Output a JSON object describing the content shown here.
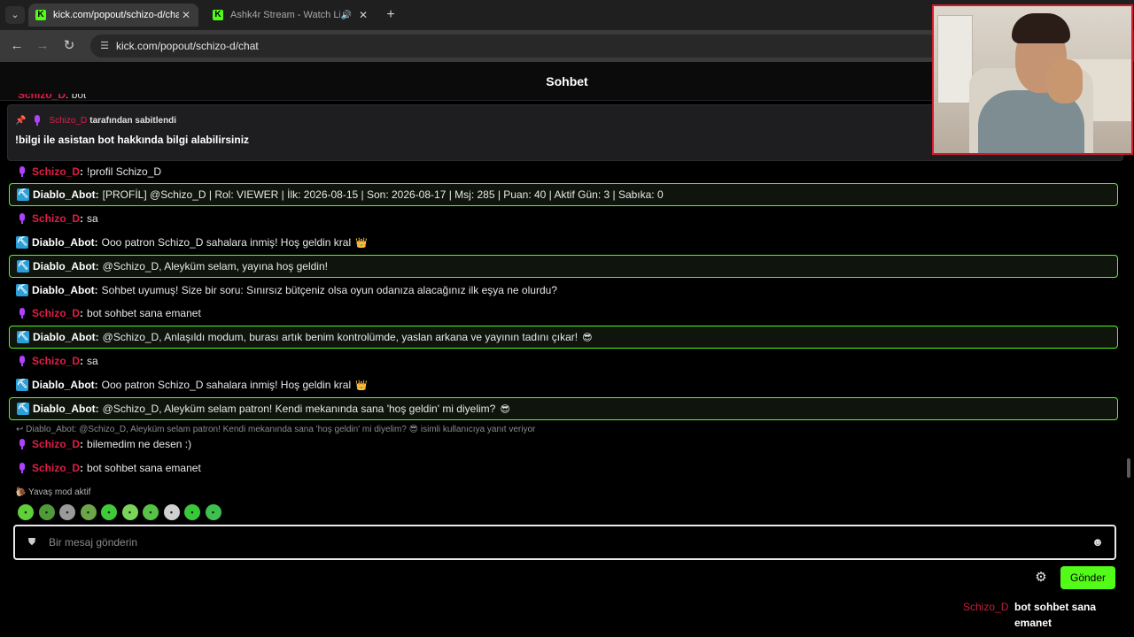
{
  "browser": {
    "tabs": [
      {
        "title": "kick.com/popout/schizo-d/chat",
        "favicon": "K",
        "active": true
      },
      {
        "title": "Ashk4r Stream - Watch Live",
        "favicon": "K",
        "active": false,
        "audio": true
      }
    ],
    "url": "kick.com/popout/schizo-d/chat"
  },
  "chat": {
    "title": "Sohbet",
    "clipped_message": {
      "user": "Schizo_D",
      "text": "bot"
    },
    "pinned": {
      "pinned_by": "Schizo_D",
      "pinned_suffix": "tarafından sabitlendi",
      "text": "!bilgi ile asistan bot hakkında bilgi alabilirsiniz"
    },
    "messages": [
      {
        "user": "Schizo_D",
        "text": "!profil Schizo_D"
      },
      {
        "user": "Diablo_Abot",
        "text": "[PROFİL] @Schizo_D | Rol: VIEWER | İlk: 2026-08-15 | Son: 2026-08-17 | Msj: 285 | Puan: 40 | Aktif Gün: 3 | Sabıka: 0"
      },
      {
        "user": "Schizo_D",
        "text": "sa"
      },
      {
        "user": "Diablo_Abot",
        "text": "Ooo patron Schizo_D sahalara inmiş! Hoş geldin kral",
        "emoji": "👑"
      },
      {
        "user": "Diablo_Abot",
        "text": "@Schizo_D, Aleyküm selam, yayına hoş geldin!"
      },
      {
        "user": "Diablo_Abot",
        "text": "Sohbet uyumuş! Size bir soru: Sınırsız bütçeniz olsa oyun odanıza alacağınız ilk eşya ne olurdu?"
      },
      {
        "user": "Schizo_D",
        "text": "bot sohbet sana emanet"
      },
      {
        "user": "Diablo_Abot",
        "text": "@Schizo_D, Anlaşıldı modum, burası artık benim kontrolümde, yaslan arkana ve yayının tadını çıkar!",
        "emoji": "😎"
      },
      {
        "user": "Schizo_D",
        "text": "sa"
      },
      {
        "user": "Diablo_Abot",
        "text": "Ooo patron Schizo_D sahalara inmiş! Hoş geldin kral",
        "emoji": "👑"
      },
      {
        "user": "Diablo_Abot",
        "text": "@Schizo_D, Aleyküm selam patron! Kendi mekanında sana 'hoş geldin' mi diyelim?",
        "emoji": "😎"
      },
      {
        "user": "Schizo_D",
        "text": "bilemedim ne desen :)"
      },
      {
        "user": "Schizo_D",
        "text": "bot sohbet sana emanet"
      }
    ],
    "reply_reference": "↩ Diablo_Abot: @Schizo_D, Aleyküm selam patron! Kendi mekanında sana 'hoş geldin' mi diyelim? 😎 isimli kullanıcıya yanıt veriyor",
    "slow_mode": "🐌 Yavaş mod aktif",
    "input_placeholder": "Bir mesaj gönderin",
    "send_label": "Gönder",
    "emotes": [
      "emote-1",
      "emote-2",
      "emote-3",
      "emote-4",
      "emote-5",
      "emote-6",
      "emote-7",
      "emote-8",
      "emote-9",
      "emote-10"
    ]
  },
  "overlay_message": {
    "user": "Schizo_D",
    "text": "bot sohbet sana emanet"
  },
  "colors": {
    "accent": "#53fc18",
    "user_red": "#e11d48",
    "bot_badge": "#2a9fd8",
    "webcam_border": "#d41c2f"
  }
}
